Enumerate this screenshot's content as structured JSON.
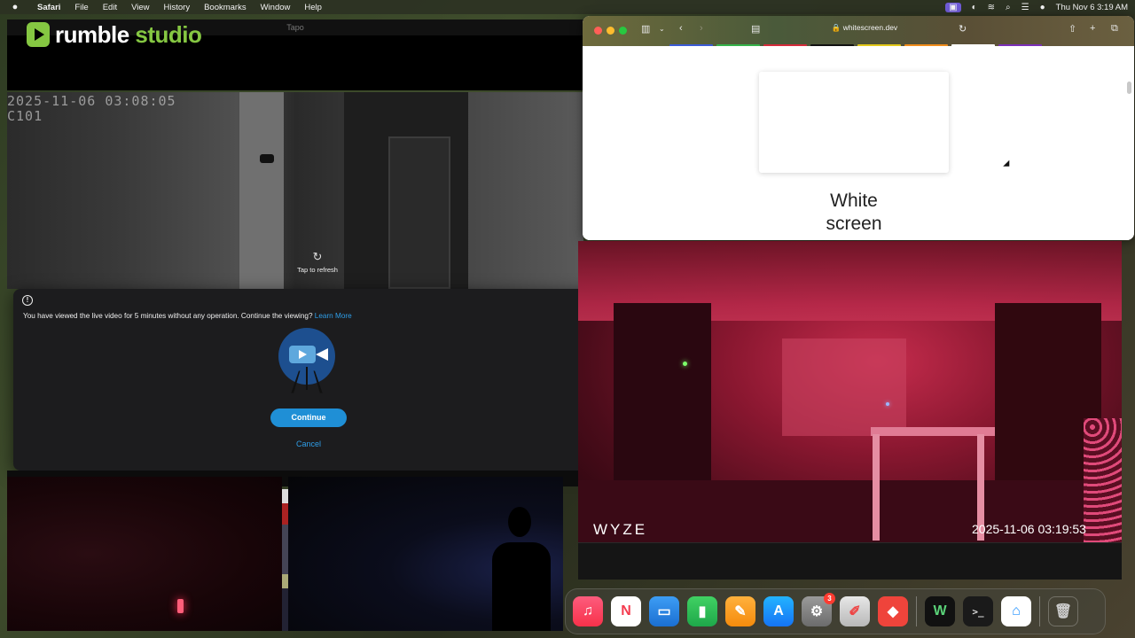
{
  "menubar": {
    "apple": "",
    "app_name": "Safari",
    "menus": [
      "File",
      "Edit",
      "View",
      "History",
      "Bookmarks",
      "Window",
      "Help"
    ],
    "datetime": "Thu Nov 6  3:19 AM"
  },
  "tapo": {
    "window_title": "Tapo",
    "brand_primary": "rumble",
    "brand_secondary": "studio",
    "camera_timestamp": "2025-11-06 03:08:05",
    "camera_id": "C101",
    "refresh_label": "Tap to refresh"
  },
  "dialog": {
    "message": "You have viewed the live video for 5 minutes without any operation. Continue the viewing?",
    "learn_more": "Learn More",
    "continue_label": "Continue",
    "cancel_label": "Cancel"
  },
  "safari": {
    "url": "whitescreen.dev",
    "page_title_line1": "White",
    "page_title_line2": "screen",
    "tab_colors": [
      "#3b5bd6",
      "#35b34a",
      "#d42a3a",
      "#111111",
      "#e3c81a",
      "#f08c1c",
      "#ffffff",
      "#7b2fb8"
    ]
  },
  "wyze": {
    "logo": "WYZE",
    "timestamp": "2025-11-06  03:19:53"
  },
  "dock": {
    "apps": [
      {
        "name": "music",
        "glyph": "♫"
      },
      {
        "name": "news",
        "glyph": "N"
      },
      {
        "name": "keynote",
        "glyph": "▭"
      },
      {
        "name": "numbers",
        "glyph": "▮"
      },
      {
        "name": "pages",
        "glyph": "✎"
      },
      {
        "name": "app-store",
        "glyph": "A"
      },
      {
        "name": "system-settings",
        "glyph": "⚙",
        "badge": "3"
      },
      {
        "name": "notes",
        "glyph": "✐"
      },
      {
        "name": "anydesk",
        "glyph": "◆"
      },
      {
        "name": "w-app",
        "glyph": "W"
      },
      {
        "name": "terminal",
        "glyph": ">_"
      },
      {
        "name": "home",
        "glyph": "⌂"
      },
      {
        "name": "trash",
        "glyph": "🗑"
      }
    ]
  }
}
